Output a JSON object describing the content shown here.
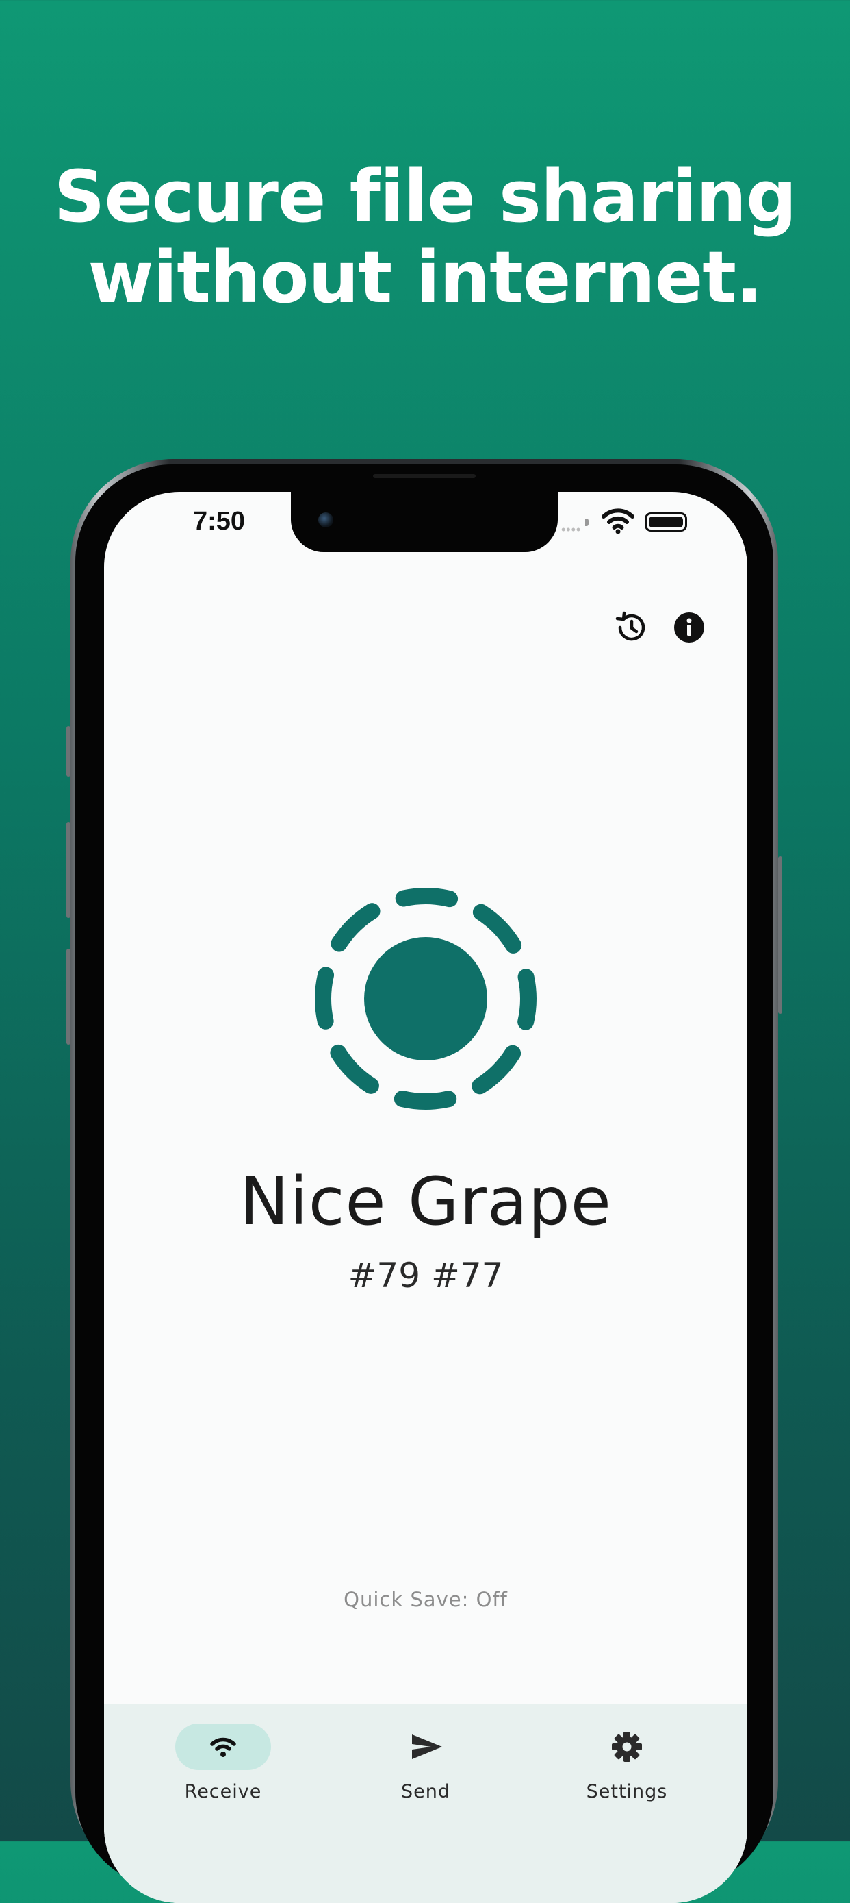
{
  "headline": {
    "line1": "Secure file sharing",
    "line2": "without internet."
  },
  "status_bar": {
    "time": "7:50",
    "signal_dots": "••••",
    "wifi_icon": "wifi-icon",
    "battery_icon": "battery-icon"
  },
  "top_actions": {
    "history_icon": "history-icon",
    "info_icon": "info-icon"
  },
  "main": {
    "logo_icon": "dashed-circle-logo-icon",
    "device_name": "Nice Grape",
    "device_id": "#79 #77",
    "quick_save": "Quick Save: Off"
  },
  "bottom_nav": {
    "items": [
      {
        "label": "Receive",
        "icon": "wifi-icon",
        "selected": true
      },
      {
        "label": "Send",
        "icon": "send-icon",
        "selected": false
      },
      {
        "label": "Settings",
        "icon": "gear-icon",
        "selected": false
      }
    ]
  },
  "colors": {
    "brand_green": "#0f7a6c",
    "background_top": "#0f9874",
    "background_bottom": "#134a48",
    "nav_background": "#e8f1ef",
    "nav_pill": "#c7e8e2"
  }
}
